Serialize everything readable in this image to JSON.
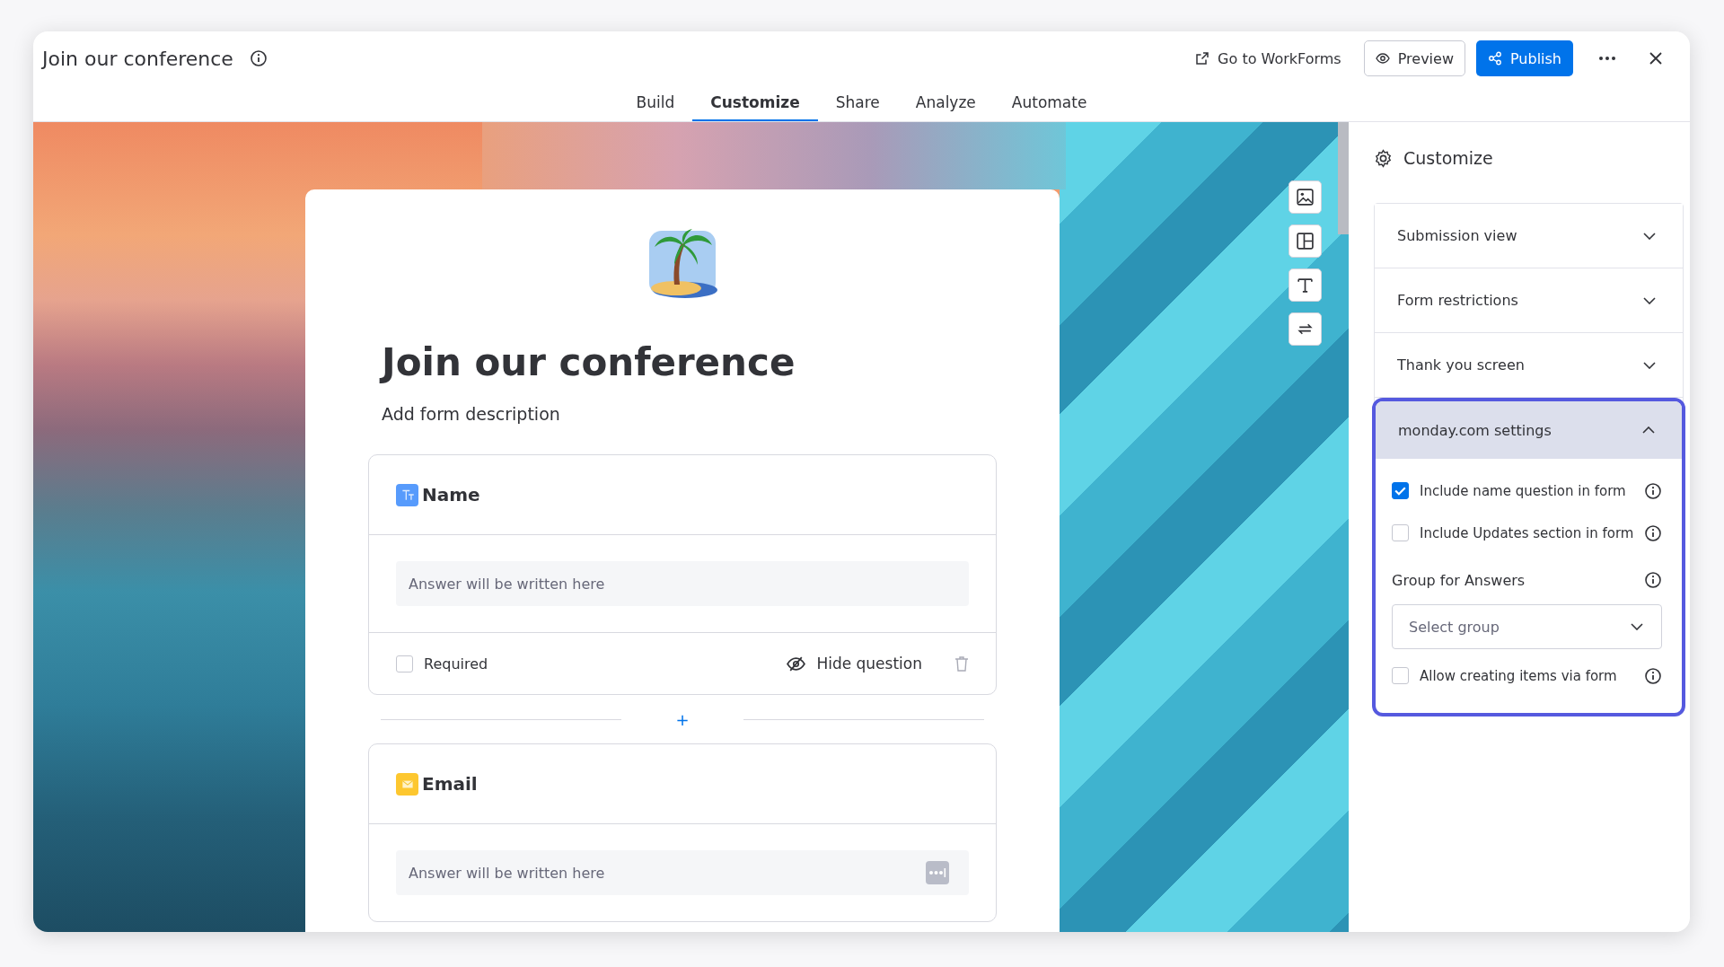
{
  "window": {
    "title": "Join our conference"
  },
  "header_actions": [
    {
      "kind": "link",
      "label": "Go to WorkForms"
    },
    {
      "kind": "outline",
      "label": "Preview"
    },
    {
      "kind": "primary",
      "label": "Publish"
    }
  ],
  "tabs": [
    {
      "label": "Build",
      "selected": false
    },
    {
      "label": "Customize",
      "selected": true
    },
    {
      "label": "Share",
      "selected": false
    },
    {
      "label": "Analyze",
      "selected": false
    },
    {
      "label": "Automate",
      "selected": false
    }
  ],
  "form": {
    "title": "Join our conference",
    "description": "Add form description",
    "questions": [
      {
        "kind": "text",
        "label": "Name",
        "placeholder": "Answer will be written here",
        "footer": {
          "required_label": "Required",
          "required": false,
          "hide_label": "Hide question"
        }
      },
      {
        "kind": "email",
        "label": "Email",
        "placeholder": "Answer will be written here"
      }
    ],
    "add_symbol": "+"
  },
  "panel": {
    "title": "Customize",
    "sections": [
      {
        "label": "Submission view",
        "expanded": false
      },
      {
        "label": "Form restrictions",
        "expanded": false
      },
      {
        "label": "Thank you screen",
        "expanded": false
      },
      {
        "label": "monday.com settings",
        "expanded": true
      }
    ],
    "settings": {
      "options": [
        {
          "label": "Include name question in form",
          "checked": true
        },
        {
          "label": "Include Updates section in form",
          "checked": false
        }
      ],
      "group_label": "Group for Answers",
      "group_placeholder": "Select group",
      "extra_options": [
        {
          "label": "Allow creating items via form",
          "checked": false
        }
      ]
    }
  }
}
